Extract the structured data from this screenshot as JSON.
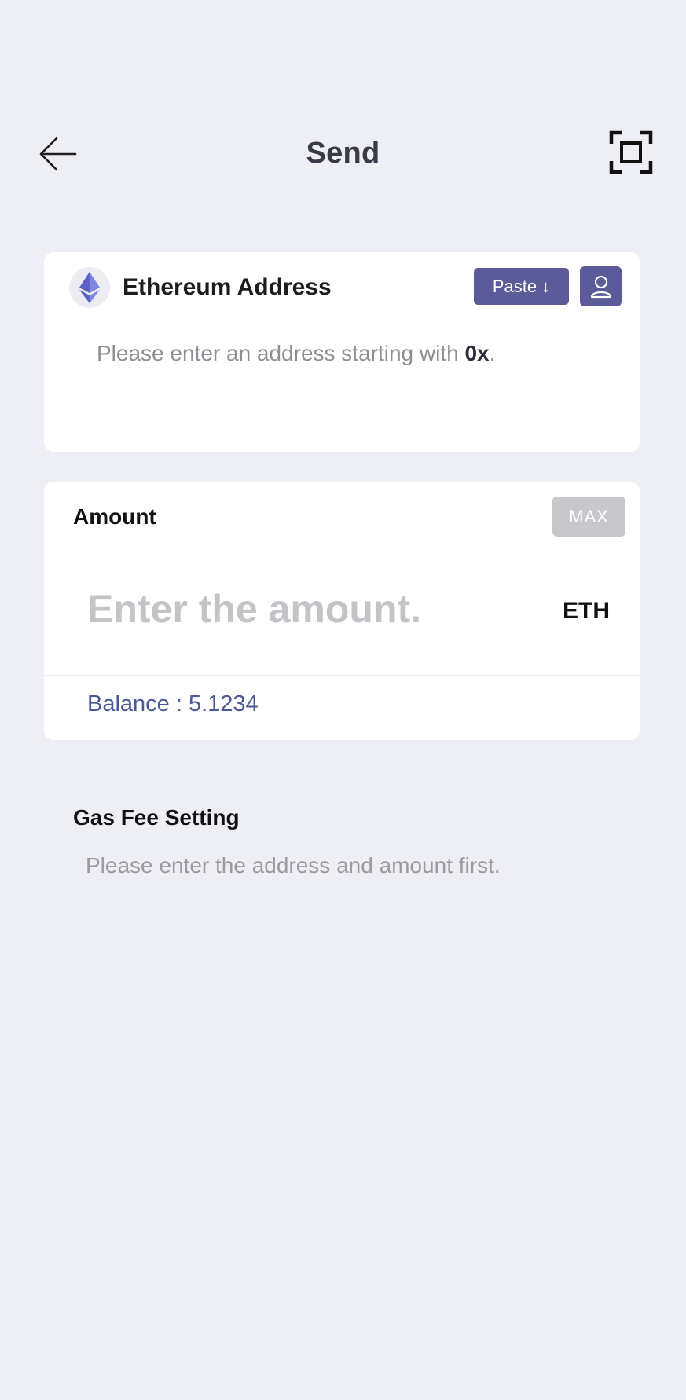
{
  "header": {
    "title": "Send",
    "back_icon": "arrow-left-icon",
    "scan_icon": "scan-qr-icon"
  },
  "address": {
    "network_icon": "ethereum-icon",
    "label": "Ethereum Address",
    "paste_label": "Paste",
    "paste_icon": "arrow-down-icon",
    "contacts_icon": "person-icon",
    "placeholder_prefix": "Please enter an address starting with ",
    "placeholder_highlight": "0x",
    "placeholder_suffix": "."
  },
  "amount": {
    "label": "Amount",
    "max_label": "MAX",
    "placeholder": "Enter the amount.",
    "unit": "ETH",
    "balance_text": "Balance : 5.1234"
  },
  "gas": {
    "title": "Gas Fee Setting",
    "description": "Please enter the address and amount first."
  },
  "colors": {
    "background": "#eeeff4",
    "accent": "#5b5b9a",
    "balance": "#4a5895",
    "ethereum": "#6b74d6"
  }
}
